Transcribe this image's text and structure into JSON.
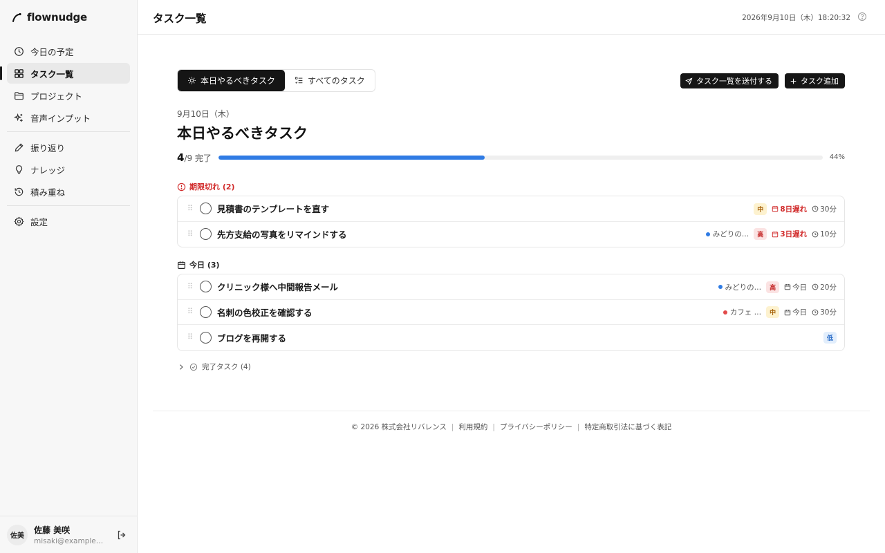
{
  "app": {
    "name": "flownudge"
  },
  "sidebar": {
    "items": [
      {
        "label": "今日の予定",
        "icon": "clock-icon"
      },
      {
        "label": "タスク一覧",
        "icon": "grid-icon",
        "active": true
      },
      {
        "label": "プロジェクト",
        "icon": "folder-icon"
      },
      {
        "label": "音声インプット",
        "icon": "sparkle-icon"
      },
      {
        "label": "振り返り",
        "icon": "pencil-icon"
      },
      {
        "label": "ナレッジ",
        "icon": "lightbulb-icon"
      },
      {
        "label": "積み重ね",
        "icon": "history-icon"
      },
      {
        "label": "設定",
        "icon": "gear-icon"
      }
    ]
  },
  "user": {
    "initials": "佐美",
    "name": "佐藤 美咲",
    "email": "misaki@example.com"
  },
  "header": {
    "title": "タスク一覧",
    "datetime": "2026年9月10日（木）18:20:32"
  },
  "tabs": {
    "today": "本日やるべきタスク",
    "all": "すべてのタスク"
  },
  "actions": {
    "send": "タスク一覧を送付する",
    "add": "タスク追加"
  },
  "section": {
    "date": "9月10日（木）",
    "title": "本日やるべきタスク"
  },
  "progress": {
    "done": "4",
    "total": "/9 完了",
    "percent_label": "44%",
    "fraction": 0.44
  },
  "groups": {
    "overdue": {
      "title": "期限切れ (2)",
      "tasks": [
        {
          "title": "見積書のテンプレートを直す",
          "project": "",
          "priority": "中",
          "due": "8日遅れ",
          "duration": "30分"
        },
        {
          "title": "先方支給の写真をリマインドする",
          "project": "みどりの…",
          "project_color": "#2f7be4",
          "priority": "高",
          "due": "3日遅れ",
          "duration": "10分"
        }
      ]
    },
    "today": {
      "title": "今日 (3)",
      "tasks": [
        {
          "title": "クリニック様へ中間報告メール",
          "project": "みどりの…",
          "project_color": "#2f7be4",
          "priority": "高",
          "due": "今日",
          "duration": "20分"
        },
        {
          "title": "名刺の色校正を確認する",
          "project": "カフェ …",
          "project_color": "#e24a4a",
          "priority": "中",
          "due": "今日",
          "duration": "30分"
        },
        {
          "title": "ブログを再開する",
          "priority": "低"
        }
      ]
    }
  },
  "completed": {
    "label": "完了タスク (4)"
  },
  "footer": {
    "copyright": "© 2026 株式会社リバレンス",
    "terms": "利用規約",
    "privacy": "プライバシーポリシー",
    "commerce": "特定商取引法に基づく表記"
  }
}
